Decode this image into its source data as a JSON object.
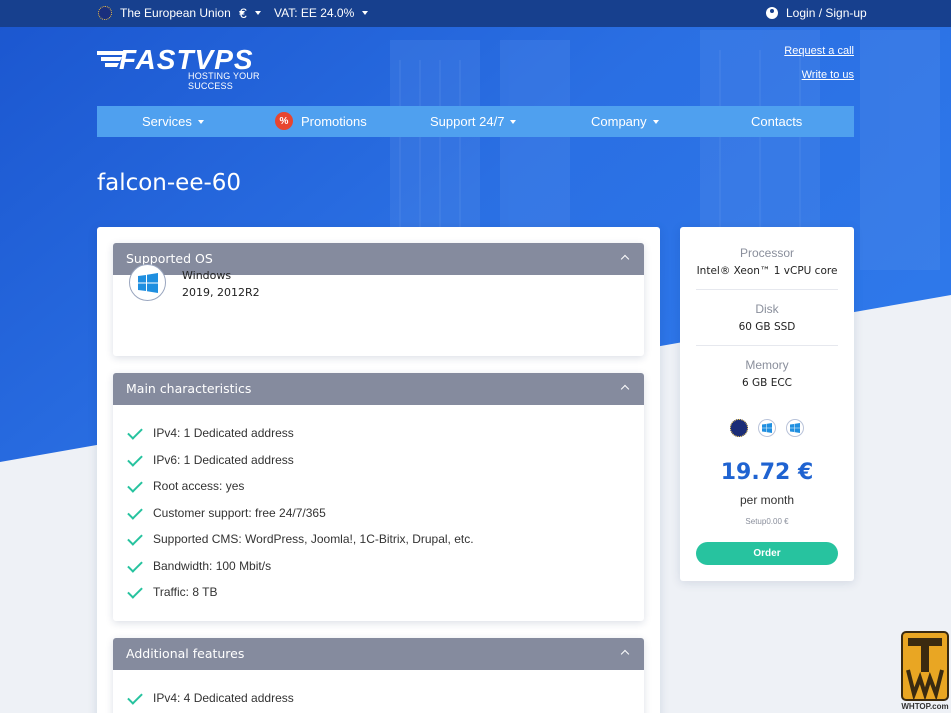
{
  "topbar": {
    "region": "The European Union",
    "currency": "€",
    "vat": "VAT: EE 24.0%",
    "login": "Login / Sign-up"
  },
  "logo": {
    "name": "FASTVPS",
    "tagline": "HOSTING YOUR SUCCESS"
  },
  "links": {
    "request_call": "Request a call",
    "write_us": "Write to us"
  },
  "nav": {
    "services": "Services",
    "promotions": "Promotions",
    "promotions_badge": "%",
    "support": "Support 24/7",
    "company": "Company",
    "contacts": "Contacts"
  },
  "page_title": "falcon-ee-60",
  "sections": {
    "os": {
      "title": "Supported OS",
      "os_name": "Windows",
      "os_versions": "2019, 2012R2"
    },
    "main": {
      "title": "Main characteristics",
      "items": [
        "IPv4: 1 Dedicated address",
        "IPv6: 1 Dedicated address",
        "Root access: yes",
        "Customer support: free 24/7/365",
        "Supported CMS: WordPress, Joomla!, 1C-Bitrix, Drupal, etc.",
        "Bandwidth: 100 Mbit/s",
        "Traffic: 8 TB"
      ]
    },
    "additional": {
      "title": "Additional features",
      "items": [
        "IPv4: 4 Dedicated address"
      ]
    }
  },
  "plan": {
    "processor_label": "Processor",
    "processor_value": "Intel® Xeon™ 1 vCPU core",
    "disk_label": "Disk",
    "disk_value": "60 GB SSD",
    "memory_label": "Memory",
    "memory_value": "6 GB ECC",
    "location_icons": [
      "eu-flag-icon",
      "windows-icon",
      "windows-icon"
    ],
    "price": "19.72 €",
    "period": "per month",
    "setup": "Setup0.00 €",
    "order_label": "Order"
  },
  "watermark": {
    "text": "WHTOP.com"
  },
  "colors": {
    "topbar": "#17408e",
    "nav": "#4fa0ef",
    "section_header": "#858b9e",
    "accent_green": "#27c39f",
    "price_blue": "#1f63d1",
    "promo_red": "#e8452f"
  }
}
